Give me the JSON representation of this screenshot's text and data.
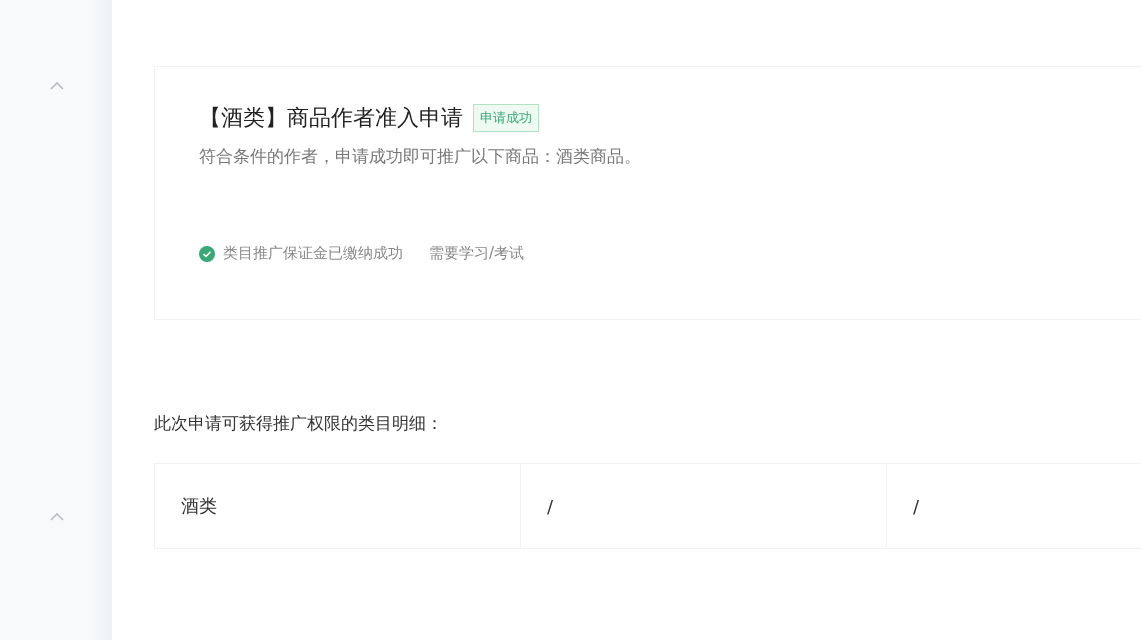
{
  "application_card": {
    "title": "【酒类】商品作者准入申请",
    "status_badge": "申请成功",
    "description": "符合条件的作者，申请成功即可推广以下商品：酒类商品。",
    "requirements": [
      {
        "kind": "done",
        "label": "类目推广保证金已缴纳成功"
      },
      {
        "kind": "plain",
        "label": "需要学习/考试"
      }
    ]
  },
  "details": {
    "heading": "此次申请可获得推广权限的类目明细：",
    "cells": [
      "酒类",
      "/",
      "/"
    ]
  }
}
